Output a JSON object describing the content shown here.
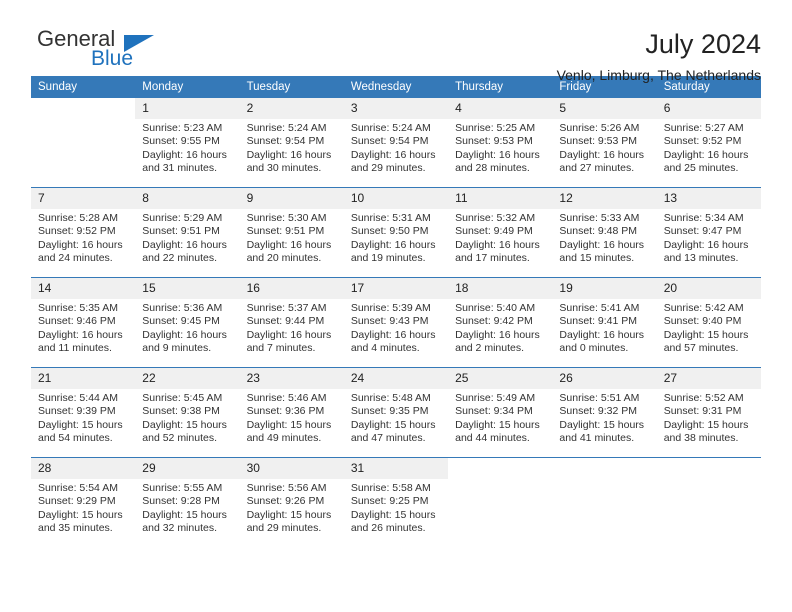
{
  "brand": {
    "name_top": "General",
    "name_bottom": "Blue",
    "accent_color": "#1f72bd",
    "triangle_icon": "triangle-icon"
  },
  "header": {
    "title": "July 2024",
    "subtitle": "Venlo, Limburg, The Netherlands"
  },
  "calendar": {
    "header_bg": "#3579b8",
    "daynum_bg": "#f0f0f0",
    "weekday_headers": [
      "Sunday",
      "Monday",
      "Tuesday",
      "Wednesday",
      "Thursday",
      "Friday",
      "Saturday"
    ],
    "labels": {
      "sunrise": "Sunrise:",
      "sunset": "Sunset:",
      "daylight": "Daylight:"
    },
    "weeks": [
      [
        {
          "day": "",
          "empty": true
        },
        {
          "day": "1",
          "sunrise": "Sunrise: 5:23 AM",
          "sunset": "Sunset: 9:55 PM",
          "daylight_1": "Daylight: 16 hours",
          "daylight_2": "and 31 minutes."
        },
        {
          "day": "2",
          "sunrise": "Sunrise: 5:24 AM",
          "sunset": "Sunset: 9:54 PM",
          "daylight_1": "Daylight: 16 hours",
          "daylight_2": "and 30 minutes."
        },
        {
          "day": "3",
          "sunrise": "Sunrise: 5:24 AM",
          "sunset": "Sunset: 9:54 PM",
          "daylight_1": "Daylight: 16 hours",
          "daylight_2": "and 29 minutes."
        },
        {
          "day": "4",
          "sunrise": "Sunrise: 5:25 AM",
          "sunset": "Sunset: 9:53 PM",
          "daylight_1": "Daylight: 16 hours",
          "daylight_2": "and 28 minutes."
        },
        {
          "day": "5",
          "sunrise": "Sunrise: 5:26 AM",
          "sunset": "Sunset: 9:53 PM",
          "daylight_1": "Daylight: 16 hours",
          "daylight_2": "and 27 minutes."
        },
        {
          "day": "6",
          "sunrise": "Sunrise: 5:27 AM",
          "sunset": "Sunset: 9:52 PM",
          "daylight_1": "Daylight: 16 hours",
          "daylight_2": "and 25 minutes."
        }
      ],
      [
        {
          "day": "7",
          "sunrise": "Sunrise: 5:28 AM",
          "sunset": "Sunset: 9:52 PM",
          "daylight_1": "Daylight: 16 hours",
          "daylight_2": "and 24 minutes."
        },
        {
          "day": "8",
          "sunrise": "Sunrise: 5:29 AM",
          "sunset": "Sunset: 9:51 PM",
          "daylight_1": "Daylight: 16 hours",
          "daylight_2": "and 22 minutes."
        },
        {
          "day": "9",
          "sunrise": "Sunrise: 5:30 AM",
          "sunset": "Sunset: 9:51 PM",
          "daylight_1": "Daylight: 16 hours",
          "daylight_2": "and 20 minutes."
        },
        {
          "day": "10",
          "sunrise": "Sunrise: 5:31 AM",
          "sunset": "Sunset: 9:50 PM",
          "daylight_1": "Daylight: 16 hours",
          "daylight_2": "and 19 minutes."
        },
        {
          "day": "11",
          "sunrise": "Sunrise: 5:32 AM",
          "sunset": "Sunset: 9:49 PM",
          "daylight_1": "Daylight: 16 hours",
          "daylight_2": "and 17 minutes."
        },
        {
          "day": "12",
          "sunrise": "Sunrise: 5:33 AM",
          "sunset": "Sunset: 9:48 PM",
          "daylight_1": "Daylight: 16 hours",
          "daylight_2": "and 15 minutes."
        },
        {
          "day": "13",
          "sunrise": "Sunrise: 5:34 AM",
          "sunset": "Sunset: 9:47 PM",
          "daylight_1": "Daylight: 16 hours",
          "daylight_2": "and 13 minutes."
        }
      ],
      [
        {
          "day": "14",
          "sunrise": "Sunrise: 5:35 AM",
          "sunset": "Sunset: 9:46 PM",
          "daylight_1": "Daylight: 16 hours",
          "daylight_2": "and 11 minutes."
        },
        {
          "day": "15",
          "sunrise": "Sunrise: 5:36 AM",
          "sunset": "Sunset: 9:45 PM",
          "daylight_1": "Daylight: 16 hours",
          "daylight_2": "and 9 minutes."
        },
        {
          "day": "16",
          "sunrise": "Sunrise: 5:37 AM",
          "sunset": "Sunset: 9:44 PM",
          "daylight_1": "Daylight: 16 hours",
          "daylight_2": "and 7 minutes."
        },
        {
          "day": "17",
          "sunrise": "Sunrise: 5:39 AM",
          "sunset": "Sunset: 9:43 PM",
          "daylight_1": "Daylight: 16 hours",
          "daylight_2": "and 4 minutes."
        },
        {
          "day": "18",
          "sunrise": "Sunrise: 5:40 AM",
          "sunset": "Sunset: 9:42 PM",
          "daylight_1": "Daylight: 16 hours",
          "daylight_2": "and 2 minutes."
        },
        {
          "day": "19",
          "sunrise": "Sunrise: 5:41 AM",
          "sunset": "Sunset: 9:41 PM",
          "daylight_1": "Daylight: 16 hours",
          "daylight_2": "and 0 minutes."
        },
        {
          "day": "20",
          "sunrise": "Sunrise: 5:42 AM",
          "sunset": "Sunset: 9:40 PM",
          "daylight_1": "Daylight: 15 hours",
          "daylight_2": "and 57 minutes."
        }
      ],
      [
        {
          "day": "21",
          "sunrise": "Sunrise: 5:44 AM",
          "sunset": "Sunset: 9:39 PM",
          "daylight_1": "Daylight: 15 hours",
          "daylight_2": "and 54 minutes."
        },
        {
          "day": "22",
          "sunrise": "Sunrise: 5:45 AM",
          "sunset": "Sunset: 9:38 PM",
          "daylight_1": "Daylight: 15 hours",
          "daylight_2": "and 52 minutes."
        },
        {
          "day": "23",
          "sunrise": "Sunrise: 5:46 AM",
          "sunset": "Sunset: 9:36 PM",
          "daylight_1": "Daylight: 15 hours",
          "daylight_2": "and 49 minutes."
        },
        {
          "day": "24",
          "sunrise": "Sunrise: 5:48 AM",
          "sunset": "Sunset: 9:35 PM",
          "daylight_1": "Daylight: 15 hours",
          "daylight_2": "and 47 minutes."
        },
        {
          "day": "25",
          "sunrise": "Sunrise: 5:49 AM",
          "sunset": "Sunset: 9:34 PM",
          "daylight_1": "Daylight: 15 hours",
          "daylight_2": "and 44 minutes."
        },
        {
          "day": "26",
          "sunrise": "Sunrise: 5:51 AM",
          "sunset": "Sunset: 9:32 PM",
          "daylight_1": "Daylight: 15 hours",
          "daylight_2": "and 41 minutes."
        },
        {
          "day": "27",
          "sunrise": "Sunrise: 5:52 AM",
          "sunset": "Sunset: 9:31 PM",
          "daylight_1": "Daylight: 15 hours",
          "daylight_2": "and 38 minutes."
        }
      ],
      [
        {
          "day": "28",
          "sunrise": "Sunrise: 5:54 AM",
          "sunset": "Sunset: 9:29 PM",
          "daylight_1": "Daylight: 15 hours",
          "daylight_2": "and 35 minutes."
        },
        {
          "day": "29",
          "sunrise": "Sunrise: 5:55 AM",
          "sunset": "Sunset: 9:28 PM",
          "daylight_1": "Daylight: 15 hours",
          "daylight_2": "and 32 minutes."
        },
        {
          "day": "30",
          "sunrise": "Sunrise: 5:56 AM",
          "sunset": "Sunset: 9:26 PM",
          "daylight_1": "Daylight: 15 hours",
          "daylight_2": "and 29 minutes."
        },
        {
          "day": "31",
          "sunrise": "Sunrise: 5:58 AM",
          "sunset": "Sunset: 9:25 PM",
          "daylight_1": "Daylight: 15 hours",
          "daylight_2": "and 26 minutes."
        },
        {
          "day": "",
          "empty": true
        },
        {
          "day": "",
          "empty": true
        },
        {
          "day": "",
          "empty": true
        }
      ]
    ]
  }
}
